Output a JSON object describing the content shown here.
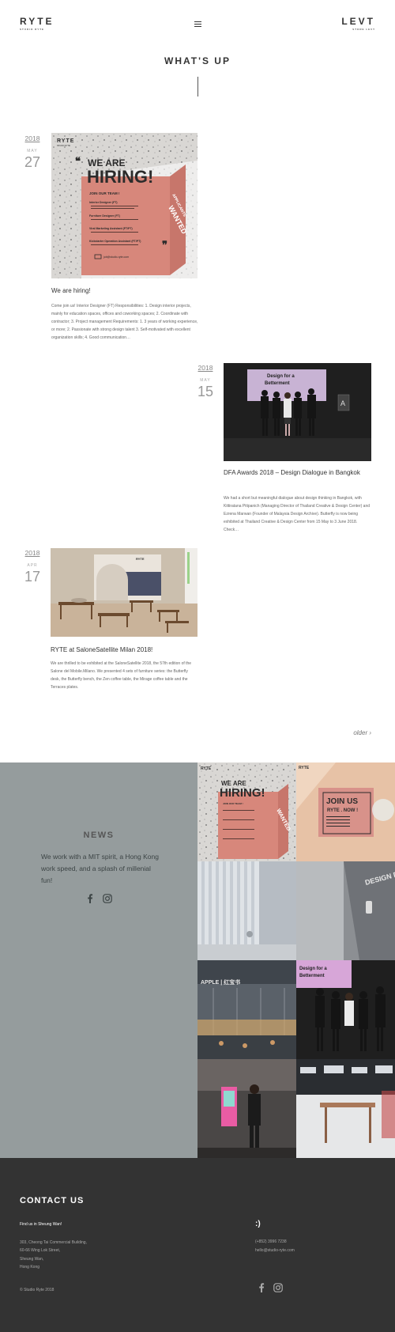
{
  "header": {
    "logo_left": "RYTE",
    "logo_left_sub": "STUDIO RYTE",
    "logo_right": "LEVT",
    "logo_right_sub": "STORE LEVT"
  },
  "section": {
    "title": "WHAT'S UP"
  },
  "posts": [
    {
      "year": "2018",
      "month": "MAY",
      "day": "27",
      "title": "We are hiring!",
      "excerpt": "Come join us! Interior Designer (FT) Responsibilities: 1. Design interior projects, mainly for education spaces, offices and coworking spaces; 2. Coordinate with contractor; 3. Project management Requirements: 1. 3 years of working experience, or more; 2. Passionate with strong design talent 3. Self-motivated with excellent organization skills; 4. Good communication…",
      "image": {
        "brand": "RYTE",
        "brand_sub": "STUDIO RYTE",
        "headline_1": "WE ARE",
        "headline_2": "HIRING!",
        "team": "JOIN OUR TEAM !",
        "roles": [
          "Interior Designer (FT)",
          "Furniture Designer (FT)",
          "Viral Marketing Assistant (FT/PT)",
          "Kickstarter Operation Assistant (FT/PT)"
        ],
        "side_1": "APPLICANTS",
        "side_2": "WANTED",
        "email": "job@studio-ryte.com"
      }
    },
    {
      "year": "2018",
      "month": "MAY",
      "day": "15",
      "title": "DFA Awards 2018 – Design Dialogue in Bangkok",
      "excerpt": "We had a short but meaningful dialogue about design thinking in Bangkok, with Kittiratana Pitipanich (Managing Director of Thailand Creative & Design Center) and Ezrena Marwan (Founder of Malaysia Design Archive). Butterfly is now being exhibited at Thailand Creative & Design Center from 15 May to 3 June 2018. Check…",
      "image": {
        "screen_1": "Design for a",
        "screen_2": "Betterment"
      }
    },
    {
      "year": "2018",
      "month": "APR",
      "day": "17",
      "title": "RYTE at SaloneSatellite Milan 2018!",
      "excerpt": "We are thrilled to be exhibited at the SaloneSatellite 2018, the 57th edition of the Salone del Mobile.Milano. We presented 4 sets of furniture series: the Butterfly desk, the Butterfly bench, the Zen coffee table, the Mirage coffee table and the Terraces plates.",
      "image": {
        "sign": "RYTE"
      }
    }
  ],
  "older_label": "older ›",
  "news": {
    "title": "NEWS",
    "text": "We work with a MIT spirit, a Hong Kong work speed, and a splash of millenial fun!",
    "grid_text": {
      "join_1": "JOIN US",
      "join_2": "RYTE . NOW !",
      "signage": "DESIGN DOMAIN",
      "apple_sign": "APPLE | 红宝书"
    }
  },
  "footer": {
    "title": "CONTACT US",
    "find_us": "Find us in Sheung Wan!",
    "address": [
      "303, Cheong Tai Commercial Building,",
      "60-66 Wing Lok Street,",
      "Sheung Wan,",
      "Hong Kong"
    ],
    "smiley": ":)",
    "phone": "(+852) 3996 7238",
    "email": "hello@studio-ryte.com",
    "copyright": "© Studio Ryte 2018"
  },
  "icons": {
    "facebook": "facebook-icon",
    "instagram": "instagram-icon",
    "menu": "hamburger-menu-icon"
  },
  "colors": {
    "news_bg": "#959c9d",
    "footer_bg": "#333333",
    "hiring_pink": "#d7877b"
  }
}
